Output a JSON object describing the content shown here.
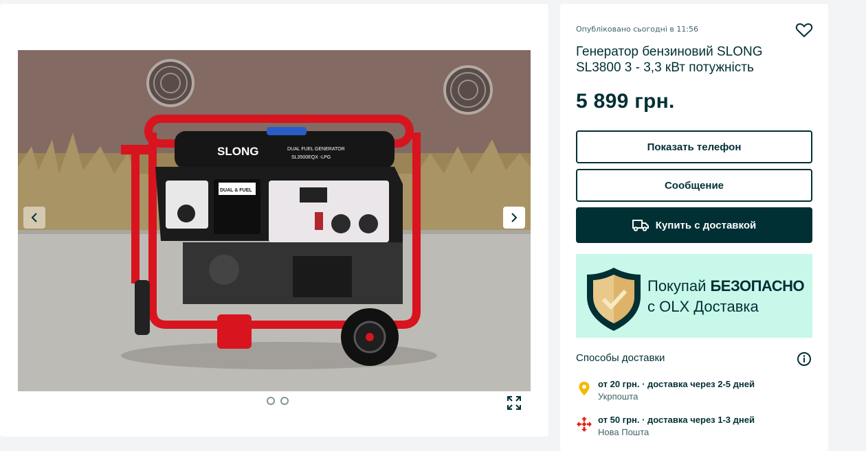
{
  "published": "Опубліковано сьогодні в 11:56",
  "title": "Генератор бензиновий SLONG SL3800 3 - 3,3 кВт потужність",
  "price": "5 899 грн.",
  "buttons": {
    "show_phone": "Показать телефон",
    "message": "Сообщение",
    "buy_delivery": "Купить с доставкой"
  },
  "promo": {
    "line1_prefix": "Покупай ",
    "line1_bold": "БЕЗОПАСНО",
    "line2": "с OLX Доставка"
  },
  "delivery": {
    "title": "Способы доставки",
    "options": [
      {
        "price_text": "от 20 грн. · доставка через 2-5 дней",
        "carrier": "Укрпошта",
        "icon": "ukrposhta-icon",
        "color": "#f5b800"
      },
      {
        "price_text": "от 50 грн. · доставка через 1-3 дней",
        "carrier": "Нова Пошта",
        "icon": "nova-poshta-icon",
        "color": "#e2231a"
      }
    ]
  },
  "gallery": {
    "photo_labels": {
      "brand": "SLONG",
      "model_top": "DUAL FUEL GENERATOR",
      "model": "SL3500EQX -LPG",
      "dual_fuel": "DUAL & FUEL"
    },
    "dots_count": 2
  },
  "colors": {
    "primary": "#002f34",
    "background": "#f2f4f5",
    "promo_bg": "#c8f8ea",
    "generator_red": "#d8141f"
  }
}
